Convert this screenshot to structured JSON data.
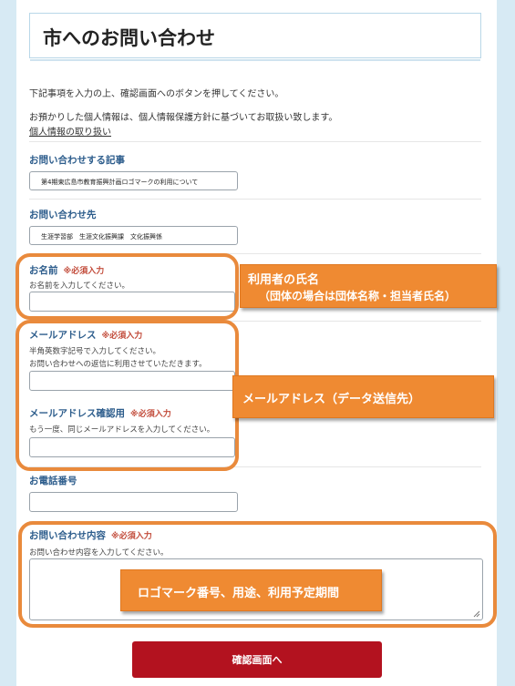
{
  "page": {
    "title": "市へのお問い合わせ",
    "intro": "下記事項を入力の上、確認画面へのボタンを押してください。",
    "privacy_note": "お預かりした個人情報は、個人情報保護方針に基づいてお取扱い致します。",
    "privacy_link": "個人情報の取り扱い"
  },
  "form": {
    "article": {
      "label": "お問い合わせする記事",
      "value": "第4期東広島市教育振興計画ロゴマークの利用について"
    },
    "recipient": {
      "label": "お問い合わせ先",
      "value": "生涯学習部　生涯文化振興課　文化振興係"
    },
    "name": {
      "label": "お名前",
      "required": "※必須入力",
      "help": "お名前を入力してください。",
      "value": ""
    },
    "email": {
      "label": "メールアドレス",
      "required": "※必須入力",
      "help1": "半角英数字記号で入力してください。",
      "help2": "お問い合わせへの返信に利用させていただきます。",
      "value": ""
    },
    "email_confirm": {
      "label": "メールアドレス確認用",
      "required": "※必須入力",
      "help": "もう一度、同じメールアドレスを入力してください。",
      "value": ""
    },
    "phone": {
      "label": "お電話番号",
      "value": ""
    },
    "content": {
      "label": "お問い合わせ内容",
      "required": "※必須入力",
      "help": "お問い合わせ内容を入力してください。",
      "value": ""
    },
    "submit_label": "確認画面へ"
  },
  "callouts": {
    "name_line1": "利用者の氏名",
    "name_line2": "（団体の場合は団体名称・担当者氏名）",
    "email": "メールアドレス（データ送信先）",
    "content": "ロゴマーク番号、用途、利用予定期間"
  },
  "colors": {
    "accent": "#e98a3c",
    "label": "#2d5d8c",
    "required": "#c24b3a",
    "submit": "#b3121f"
  }
}
